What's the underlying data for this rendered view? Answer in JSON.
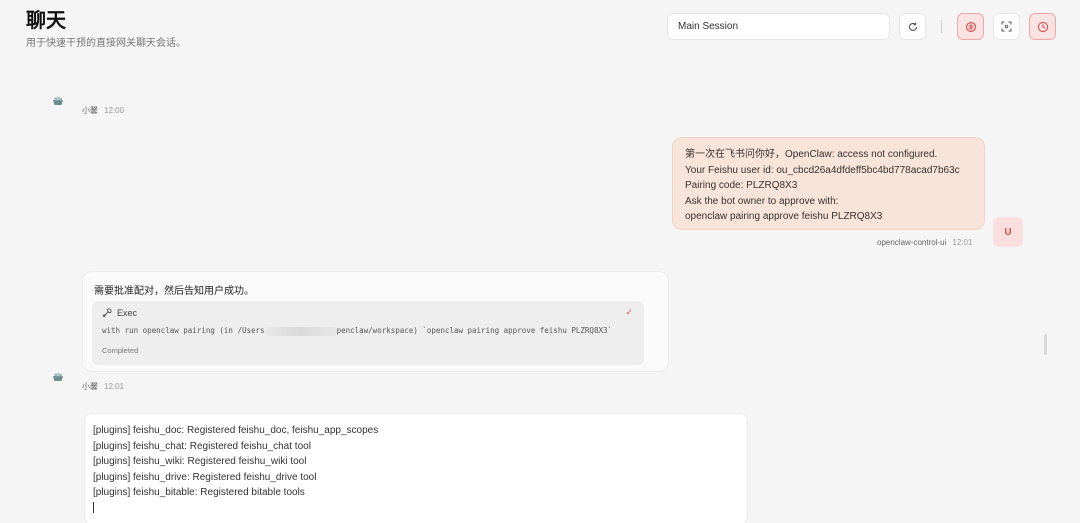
{
  "header": {
    "title": "聊天",
    "subtitle": "用于快速干预的直接网关聊天会话。",
    "session_value": "Main Session"
  },
  "icons": {
    "refresh": "refresh-icon",
    "brain": "brain-icon",
    "focus": "focus-icon",
    "clock": "clock-icon"
  },
  "messages": {
    "bot1": {
      "name": "小馨",
      "time": "12:00"
    },
    "user": {
      "lines": [
        "第一次在飞书问你好，OpenClaw: access not configured.",
        "Your Feishu user id: ou_cbcd26a4dfdeff5bc4bd778acad7b63c",
        "Pairing code: PLZRQ8X3",
        "Ask the bot owner to approve with:",
        "openclaw pairing approve feishu PLZRQ8X3"
      ],
      "sender": "openclaw-control-ui",
      "time": "12:01",
      "avatar": "U"
    },
    "bot2": {
      "text": "需要批准配对，然后告知用户成功。",
      "exec": {
        "label": "Exec",
        "cmd_prefix": "with run openclaw pairing (in /Users",
        "cmd_suffix": "penclaw/workspace) `openclaw pairing approve feishu PLZRQ8X3`",
        "status": "Completed"
      },
      "name": "小馨",
      "time": "12:01"
    }
  },
  "log": {
    "lines": [
      "[plugins] feishu_doc: Registered feishu_doc, feishu_app_scopes",
      "[plugins] feishu_chat: Registered feishu_chat tool",
      "[plugins] feishu_wiki: Registered feishu_wiki tool",
      "[plugins] feishu_drive: Registered feishu_drive tool",
      "[plugins] feishu_bitable: Registered bitable tools"
    ]
  },
  "colors": {
    "accent_red": "#d9534f",
    "user_bubble": "#f9e4d9"
  }
}
